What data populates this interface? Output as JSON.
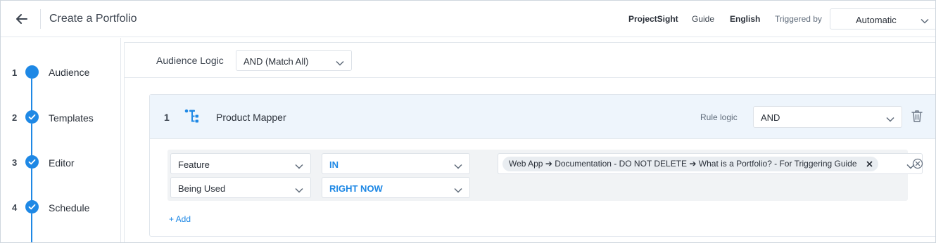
{
  "header": {
    "title": "Create a Portfolio",
    "nav": {
      "project": "ProjectSight",
      "guide": "Guide",
      "language": "English",
      "triggered_by_label": "Triggered by",
      "triggered_by_value": "Automatic"
    }
  },
  "sidebar": {
    "steps": [
      {
        "num": "1",
        "label": "Audience",
        "state": "current"
      },
      {
        "num": "2",
        "label": "Templates",
        "state": "done"
      },
      {
        "num": "3",
        "label": "Editor",
        "state": "done"
      },
      {
        "num": "4",
        "label": "Schedule",
        "state": "done"
      }
    ]
  },
  "main": {
    "audience_logic_label": "Audience Logic",
    "audience_logic_value": "AND (Match All)",
    "rule": {
      "number": "1",
      "icon": "hierarchy-icon",
      "name": "Product Mapper",
      "logic_label": "Rule logic",
      "logic_value": "AND",
      "conditions": {
        "field1": "Feature",
        "operator1": "IN",
        "token": "Web App ➔ Documentation - DO NOT DELETE ➔ What is a Portfolio? - For Triggering Guide",
        "field2": "Being Used",
        "operator2": "RIGHT NOW"
      },
      "add_label": "+ Add"
    }
  },
  "colors": {
    "accent": "#1e88e5",
    "rule_header_bg": "#eef5fc",
    "condition_bg": "#f1f3f5"
  }
}
